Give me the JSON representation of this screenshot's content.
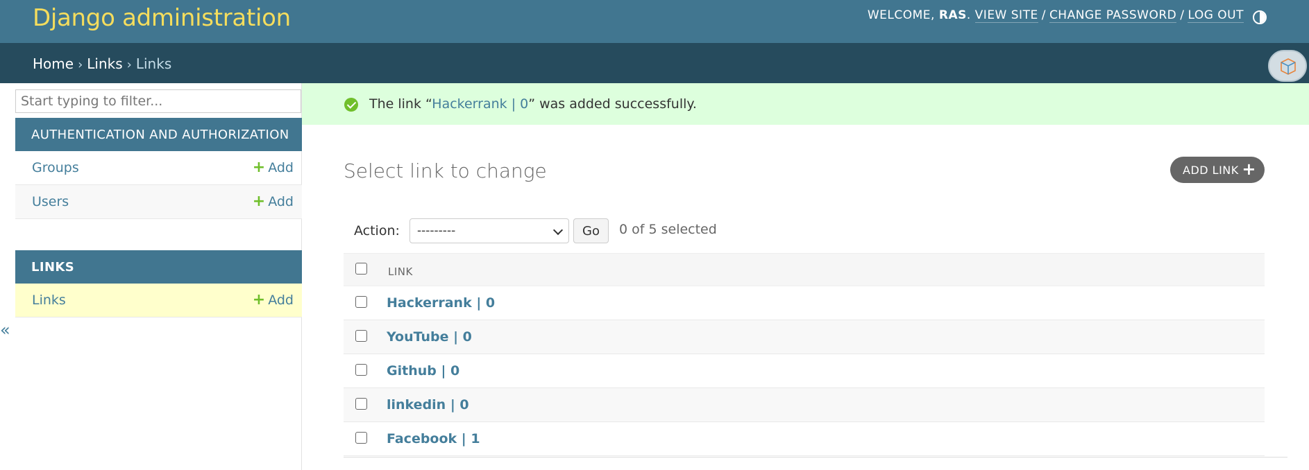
{
  "header": {
    "site_name": "Django administration",
    "welcome": "WELCOME, ",
    "username": "RAS",
    "view_site": "VIEW SITE",
    "change_password": "CHANGE PASSWORD",
    "log_out": "LOG OUT",
    "separator": "/"
  },
  "breadcrumbs": {
    "home": "Home",
    "app": "Links",
    "current": "Links",
    "arrow": "›"
  },
  "sidebar": {
    "filter_placeholder": "Start typing to filter...",
    "collapse": "«",
    "modules": [
      {
        "caption": "AUTHENTICATION AND AUTHORIZATION",
        "models": [
          {
            "name": "Groups",
            "add": "Add"
          },
          {
            "name": "Users",
            "add": "Add"
          }
        ]
      },
      {
        "caption": "LINKS",
        "models": [
          {
            "name": "Links",
            "add": "Add"
          }
        ]
      }
    ]
  },
  "message": {
    "prefix": "The link “",
    "object": "Hackerrank | 0",
    "suffix": "” was added successfully."
  },
  "content": {
    "title": "Select link to change",
    "add_button": "ADD LINK",
    "action_label": "Action:",
    "action_selected": "---------",
    "go": "Go",
    "selected_count": "0 of 5 selected",
    "column_header": "LINK",
    "rows": [
      {
        "label": "Hackerrank | 0"
      },
      {
        "label": "YouTube | 0"
      },
      {
        "label": "Github | 0"
      },
      {
        "label": "linkedin | 0"
      },
      {
        "label": "Facebook | 1"
      }
    ]
  }
}
